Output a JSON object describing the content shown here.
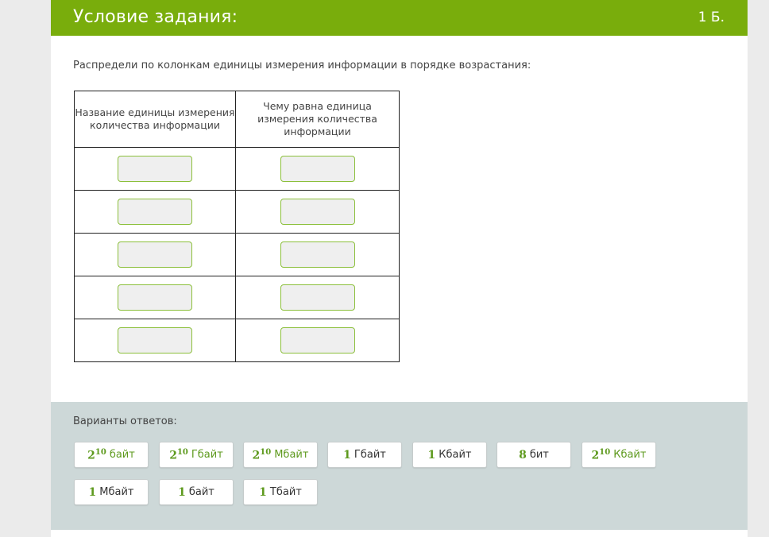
{
  "header": {
    "title": "Условие задания:",
    "score": "1 Б."
  },
  "instruction": "Распредели по колонкам единицы измерения информации в порядке возрастания:",
  "table": {
    "headers": [
      "Название единицы измерения количества информации",
      "Чему равна единица измерения количества информации"
    ],
    "row_count": 5
  },
  "options": {
    "label": "Варианты ответов:",
    "items": [
      {
        "base": "2",
        "exp": "10",
        "unit": "байт",
        "unit_style": "green"
      },
      {
        "base": "2",
        "exp": "10",
        "unit": "Гбайт",
        "unit_style": "green"
      },
      {
        "base": "2",
        "exp": "10",
        "unit": "Мбайт",
        "unit_style": "green"
      },
      {
        "base": "1",
        "exp": "",
        "unit": "Гбайт",
        "unit_style": "plain"
      },
      {
        "base": "1",
        "exp": "",
        "unit": "Кбайт",
        "unit_style": "plain"
      },
      {
        "base": "8",
        "exp": "",
        "unit": "бит",
        "unit_style": "plain"
      },
      {
        "base": "2",
        "exp": "10",
        "unit": "Кбайт",
        "unit_style": "green"
      },
      {
        "base": "1",
        "exp": "",
        "unit": "Мбайт",
        "unit_style": "plain"
      },
      {
        "base": "1",
        "exp": "",
        "unit": "байт",
        "unit_style": "plain"
      },
      {
        "base": "1",
        "exp": "",
        "unit": "Тбайт",
        "unit_style": "plain"
      }
    ]
  },
  "colors": {
    "header_bg": "#79ad0c",
    "accent_green": "#5e9a1e",
    "slot_border": "#8bbf3a",
    "options_panel_bg": "#cdd8d8"
  }
}
